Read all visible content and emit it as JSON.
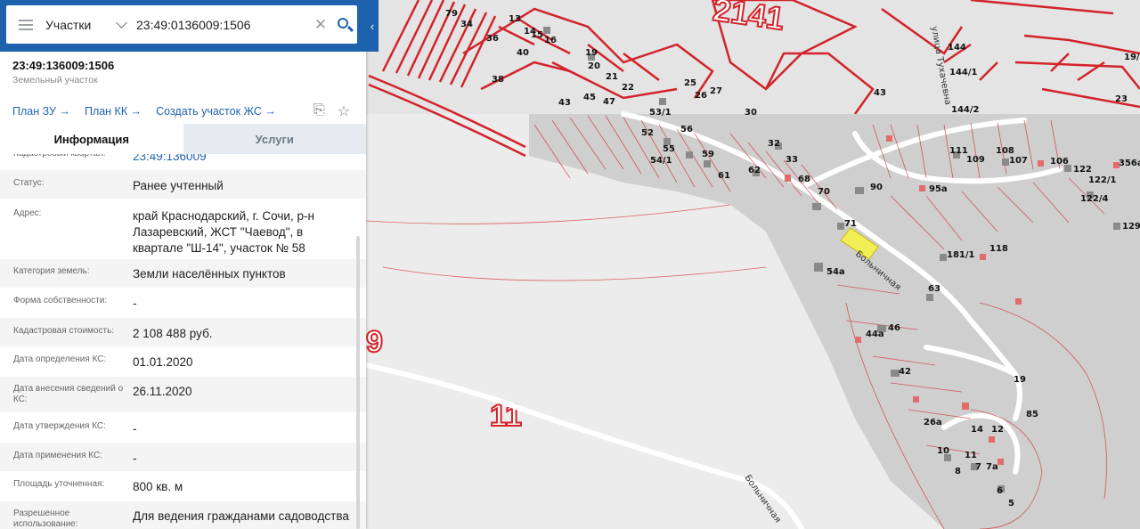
{
  "search": {
    "layer": "Участки",
    "query": "23:49:0136009:1506"
  },
  "object": {
    "title": "23:49:136009:1506",
    "type": "Земельный участок"
  },
  "actions": [
    "План ЗУ",
    "План КК",
    "Создать участок ЖС"
  ],
  "tabs": {
    "info": "Информация",
    "services": "Услуги"
  },
  "rows": [
    {
      "label": "Кадастровый квартал:",
      "value": "23:49:136009",
      "link": true
    },
    {
      "label": "Статус:",
      "value": "Ранее учтенный"
    },
    {
      "label": "Адрес:",
      "value": "край Краснодарский, г. Сочи, р-н Лазаревский, ЖСТ \"Чаевод\", в квартале \"Ш-14\", участок № 58"
    },
    {
      "label": "Категория земель:",
      "value": "Земли населённых пунктов"
    },
    {
      "label": "Форма собственности:",
      "value": "-"
    },
    {
      "label": "Кадастровая стоимость:",
      "value": "2 108 488 руб."
    },
    {
      "label": "Дата определения КС:",
      "value": "01.01.2020"
    },
    {
      "label": "Дата внесения сведений о КС:",
      "value": "26.11.2020"
    },
    {
      "label": "Дата утверждения КС:",
      "value": "-"
    },
    {
      "label": "Дата применения КС:",
      "value": "-"
    },
    {
      "label": "Площадь уточненная:",
      "value": "800 кв. м"
    },
    {
      "label": "Разрешенное использование:",
      "value": "Для ведения гражданами садоводства и огородничества"
    }
  ],
  "map": {
    "big_labels": [
      "2141",
      "11",
      "9"
    ],
    "streets": [
      "улица Тухачевна",
      "Больничная",
      "Больничная"
    ],
    "parcel_labels": [
      "79",
      "34",
      "13",
      "14",
      "15",
      "16",
      "36",
      "40",
      "38",
      "19",
      "20",
      "21",
      "22",
      "25",
      "26",
      "27",
      "43",
      "45",
      "47",
      "53/1",
      "30",
      "52",
      "56",
      "55",
      "54/1",
      "59",
      "61",
      "62",
      "32",
      "33",
      "68",
      "70",
      "90",
      "71",
      "54a",
      "63",
      "44a",
      "46",
      "42",
      "26a",
      "10",
      "11",
      "8",
      "7",
      "7a",
      "14",
      "12",
      "6",
      "5",
      "19",
      "85",
      "144",
      "144/1",
      "144/2",
      "43",
      "111",
      "109",
      "108",
      "107",
      "106",
      "122",
      "122/1",
      "122/4",
      "95a",
      "181/1",
      "118",
      "129",
      "356a",
      "19/",
      "23"
    ]
  },
  "colors": {
    "brand": "#1e62ae",
    "parcel_line": "#d2232a",
    "parcel_fill": "#bdbdbd"
  }
}
